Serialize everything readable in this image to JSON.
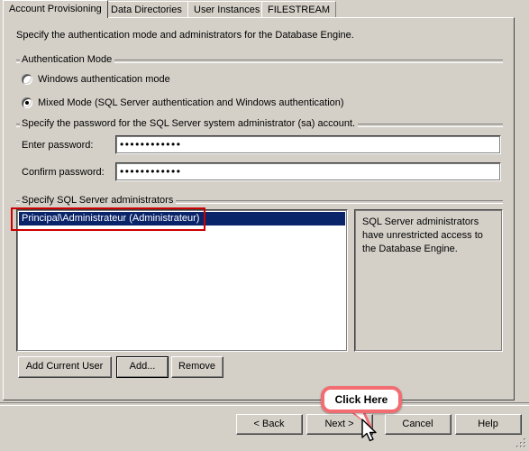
{
  "tabs": [
    {
      "label": "Account Provisioning",
      "active": true
    },
    {
      "label": "Data Directories",
      "active": false
    },
    {
      "label": "User Instances",
      "active": false
    },
    {
      "label": "FILESTREAM",
      "active": false
    }
  ],
  "page": {
    "intro": "Specify the authentication mode and administrators for the Database Engine."
  },
  "auth_group": {
    "title": "Authentication Mode",
    "options": [
      {
        "label": "Windows authentication mode",
        "selected": false
      },
      {
        "label": "Mixed Mode (SQL Server authentication and Windows authentication)",
        "selected": true
      }
    ]
  },
  "password_group": {
    "title": "Specify the password for the SQL Server system administrator (sa) account.",
    "enter_label": "Enter password:",
    "enter_value": "••••••••••••",
    "confirm_label": "Confirm password:",
    "confirm_value": "••••••••••••"
  },
  "admin_group": {
    "title": "Specify SQL Server administrators",
    "items": [
      {
        "label": "Principal\\Administrateur (Administrateur)",
        "selected": true
      }
    ],
    "info_text": "SQL Server administrators have unrestricted access to the Database Engine.",
    "buttons": [
      {
        "label": "Add Current User",
        "default": false
      },
      {
        "label": "Add...",
        "default": true
      },
      {
        "label": "Remove",
        "default": false
      }
    ]
  },
  "wizard_buttons": [
    {
      "label": "< Back"
    },
    {
      "label": "Next >"
    },
    {
      "label": "Cancel"
    },
    {
      "label": "Help"
    }
  ],
  "annotations": {
    "callout_text": "Click Here",
    "callout_border_color": "#f26d72",
    "highlight_box_color": "#cc0000"
  },
  "icons": {
    "cursor": "mouse-pointer-icon",
    "resize": "resize-grip-icon"
  }
}
